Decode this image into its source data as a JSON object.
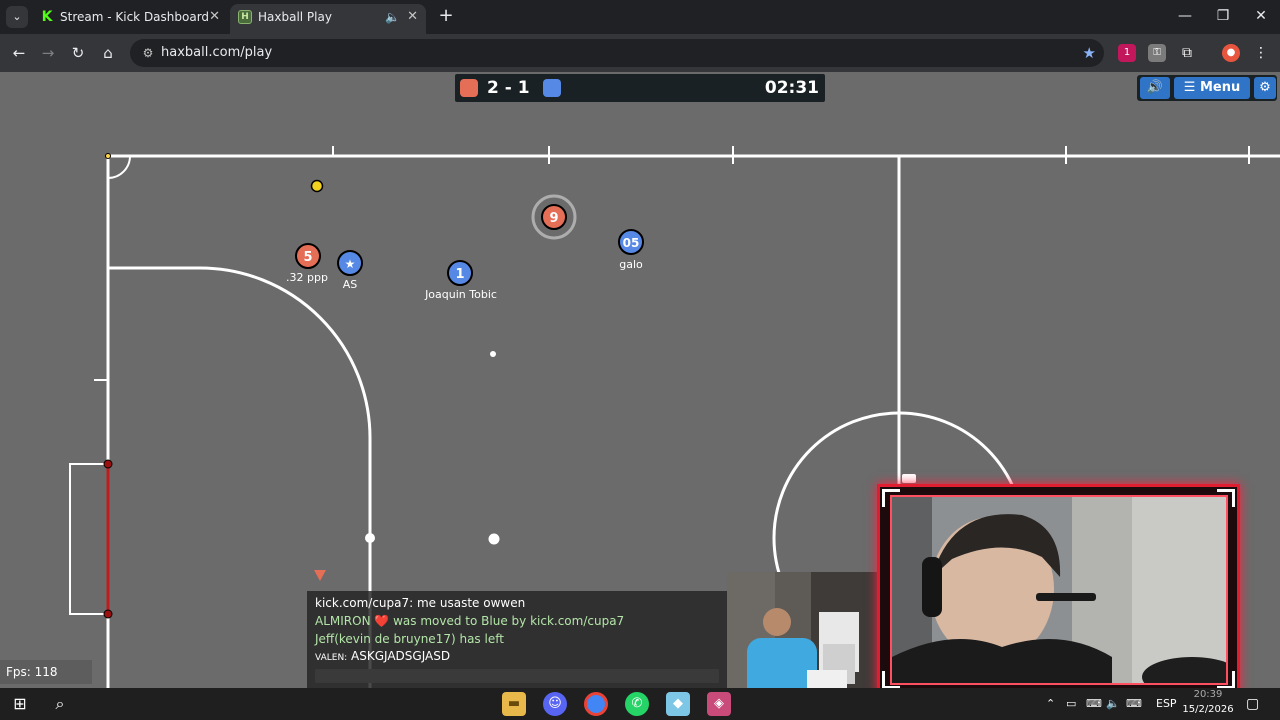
{
  "browser": {
    "tabs": [
      {
        "title": "Stream - Kick Dashboard",
        "favicon": "kick-logo-icon"
      },
      {
        "title": "Haxball Play",
        "favicon": "haxball-logo-icon",
        "active": true
      }
    ],
    "url": "haxball.com/play",
    "window_controls": [
      "minimize",
      "maximize",
      "close"
    ],
    "extension_badge": "1"
  },
  "game": {
    "score": {
      "red": 2,
      "blue": 1,
      "text": "2 - 1"
    },
    "timer": "02:31",
    "menu_label": "Menu",
    "colors": {
      "red_team": "#e56e56",
      "blue_team": "#5689e5",
      "field": "#6b6b6b",
      "ball": "#ffffff",
      "ring": "#e2e2b0"
    },
    "players": [
      {
        "team": "red",
        "number": "5",
        "name": ".32 ppp"
      },
      {
        "team": "blue",
        "number": "★",
        "name": "AS"
      },
      {
        "team": "blue",
        "number": "1",
        "name": "Joaquin Tobic"
      },
      {
        "team": "red",
        "number": "9",
        "name": ""
      },
      {
        "team": "blue",
        "number": "05",
        "name": "galo"
      }
    ],
    "fps_label": "Fps: 118",
    "chat": [
      {
        "text": "kick.com/cupa7: me usaste owwen",
        "color": "white"
      },
      {
        "text": "ALMIRON ❤️ was moved to Blue by kick.com/cupa7",
        "color": "green"
      },
      {
        "text": "Jeff(kevin de bruyne17) has left",
        "color": "green"
      },
      {
        "name": "VALEN:",
        "text": " ASKGJADSGJASD",
        "color": "white"
      }
    ]
  },
  "taskbar": {
    "language": "ESP",
    "date": "15/2/2026",
    "time": "20:39"
  }
}
